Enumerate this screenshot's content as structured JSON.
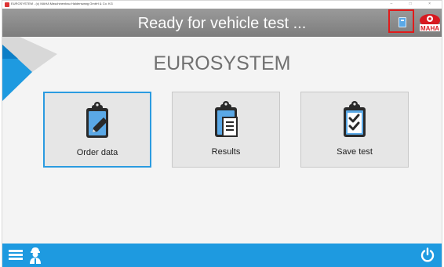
{
  "window": {
    "title": "EUROSYSTEM - (c) MAHA Maschinenbau Haldenwang GmbH & Co. KG",
    "controls": "– □ ×"
  },
  "header": {
    "status": "Ready for vehicle test ...",
    "brand_logo": "maha-logo",
    "calculator_icon": "calculator-icon"
  },
  "main": {
    "brand": "EUROSYSTEM",
    "tiles": [
      {
        "label": "Order data",
        "icon": "clipboard-pencil-icon",
        "selected": true
      },
      {
        "label": "Results",
        "icon": "clipboard-document-icon",
        "selected": false
      },
      {
        "label": "Save test",
        "icon": "clipboard-checklist-icon",
        "selected": false
      }
    ]
  },
  "footer": {
    "menu_icon": "hamburger-menu-icon",
    "user_icon": "mechanic-user-icon",
    "power_icon": "power-icon"
  },
  "colors": {
    "accent": "#1e9ae0",
    "header": "#8a8a8a",
    "highlight": "#e01b1b",
    "icon_dark": "#2a2a2a",
    "icon_blue": "#5aa8e6"
  }
}
